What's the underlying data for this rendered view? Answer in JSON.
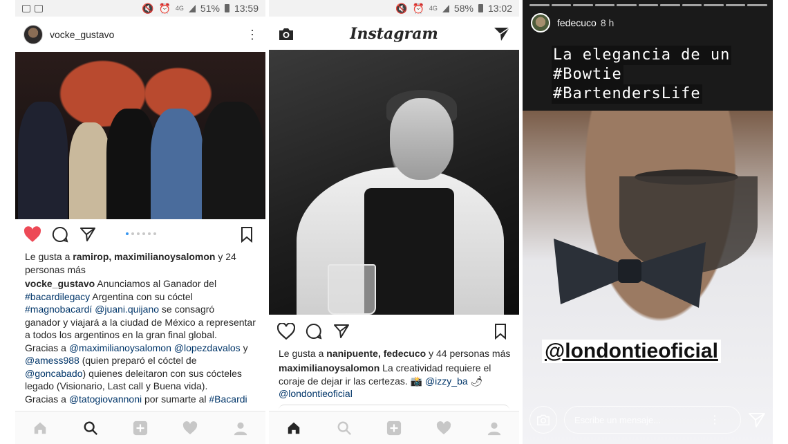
{
  "panel1": {
    "status": {
      "battery": "51%",
      "time": "13:59",
      "net": "4G"
    },
    "header": {
      "username": "vocke_gustavo"
    },
    "likes": {
      "prefix": "Le gusta a ",
      "names": "ramirop, maximilianoysalomon",
      "suffix_line1": " y 24",
      "suffix_line2": "personas más"
    },
    "caption": {
      "author": "vocke_gustavo",
      "l1": " Anunciamos al Ganador del",
      "l2_tag": "#bacardilegacy",
      "l2": " Argentina con su cóctel",
      "l3_tag1": "#magnobacardí",
      "l3_sp": " ",
      "l3_tag2": "@juani.quijano",
      "l3": " se consagró",
      "l4": "ganador y viajará a la ciudad de México a representar",
      "l5": "a todos los argentinos en la gran final global.",
      "l6_a": "Gracias a ",
      "l6_tag1": "@maximilianoysalomon",
      "l6_b": "  ",
      "l6_tag2": "@lopezdavalos",
      "l6_c": " y",
      "l7_tag": "@amess988",
      "l7": " (quien preparó el cóctel de",
      "l8_tag": "@goncabado",
      "l8": ") quienes deleitaron con sus cócteles",
      "l9": "legado (Visionario, Last call y Buena vida).",
      "l10_a": "Gracias a ",
      "l10_tag1": "@tatogiovannoni",
      "l10_b": " por sumarte al ",
      "l10_tag2": "#Bacardi"
    }
  },
  "panel2": {
    "status": {
      "battery": "58%",
      "time": "13:02",
      "net": "4G"
    },
    "logo": "Instagram",
    "likes": {
      "prefix": "Le gusta a ",
      "names": "nanipuente, fedecuco",
      "suffix": " y 44 personas más"
    },
    "caption": {
      "author": "maximilianoysalomon",
      "l1": " La creatividad requiere el",
      "l2": "coraje de dejar ir las certezas. 📸 ",
      "l2_tag": "@izzy_ba",
      "l2_end": " 🌶",
      "l3_tag": "@londontieoficial"
    }
  },
  "panel3": {
    "user": "fedecuco",
    "time": "8 h",
    "text_lines": [
      "La elegancia de un",
      "#Bowtie",
      "#BartendersLife"
    ],
    "mention": "@londontieoficial",
    "message_placeholder": "Escribe un mensaje..."
  }
}
